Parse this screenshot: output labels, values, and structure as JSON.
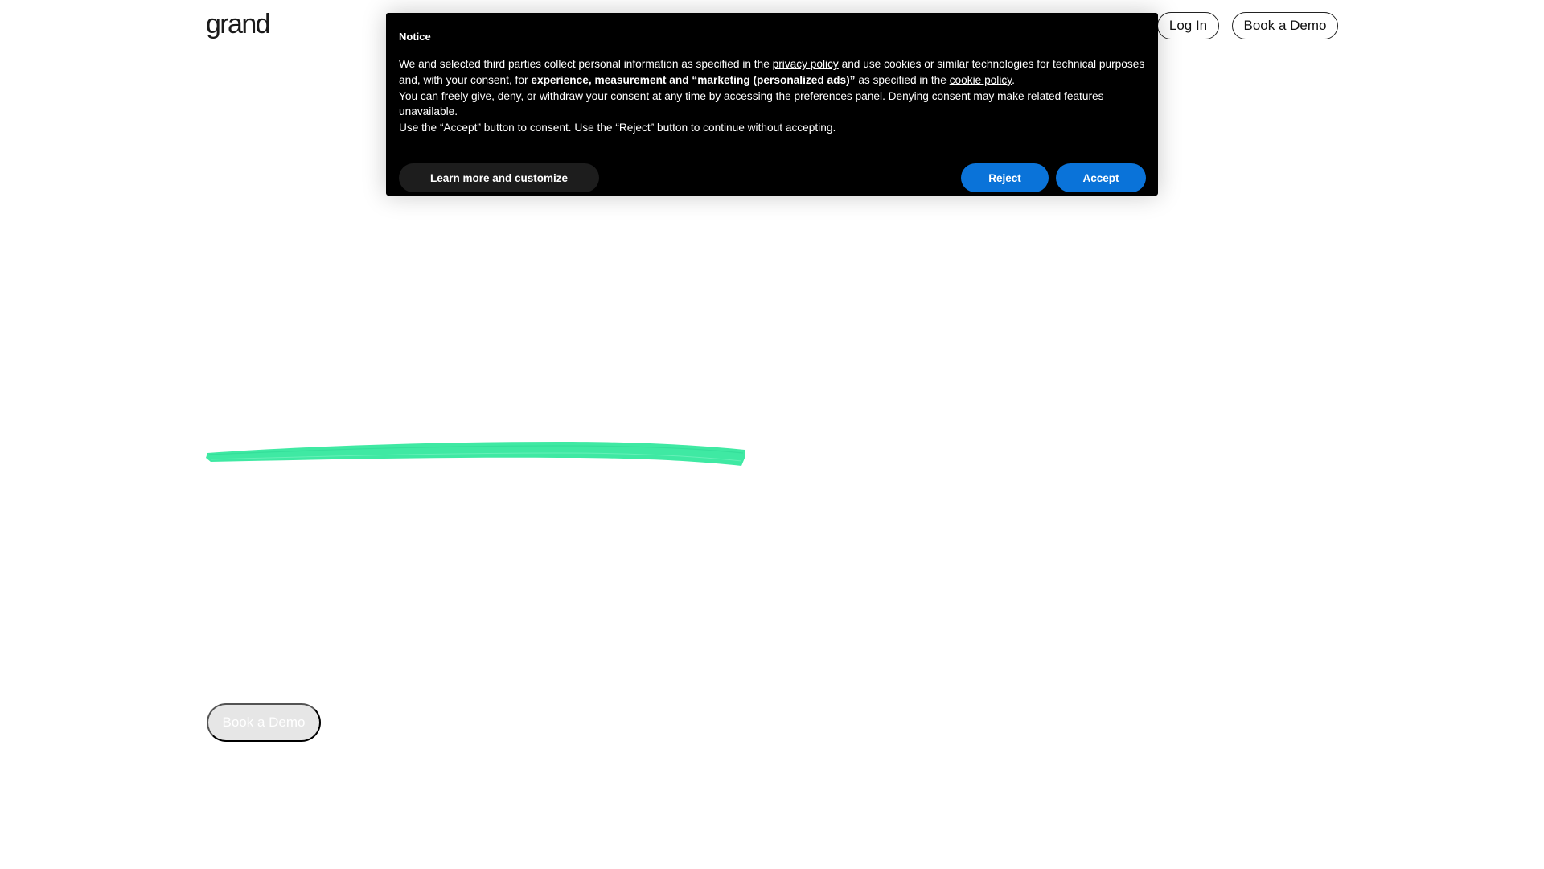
{
  "header": {
    "logo_text": "grand",
    "login_label": "Log In",
    "book_demo_label": "Book a Demo"
  },
  "hero": {
    "book_demo_label": "Book a Demo",
    "accent_color": "#3fe9a3"
  },
  "notice": {
    "title": "Notice",
    "p1_a": "We and selected third parties collect personal information as specified in the ",
    "privacy_link": "privacy policy",
    "p1_b": " and use cookies or similar technologies for technical purposes and, with your consent, for ",
    "p1_bold": "experience, measurement and “marketing (personalized ads)”",
    "p1_c": " as specified in the ",
    "cookie_link": "cookie policy",
    "p1_d": ".",
    "p2": "You can freely give, deny, or withdraw your consent at any time by accessing the preferences panel. Denying consent may make related features unavailable.",
    "p3": "Use the “Accept” button to consent. Use the “Reject” button to continue without accepting.",
    "learn_label": "Learn more and customize",
    "reject_label": "Reject",
    "accept_label": "Accept",
    "button_color": "#0a73d9"
  }
}
